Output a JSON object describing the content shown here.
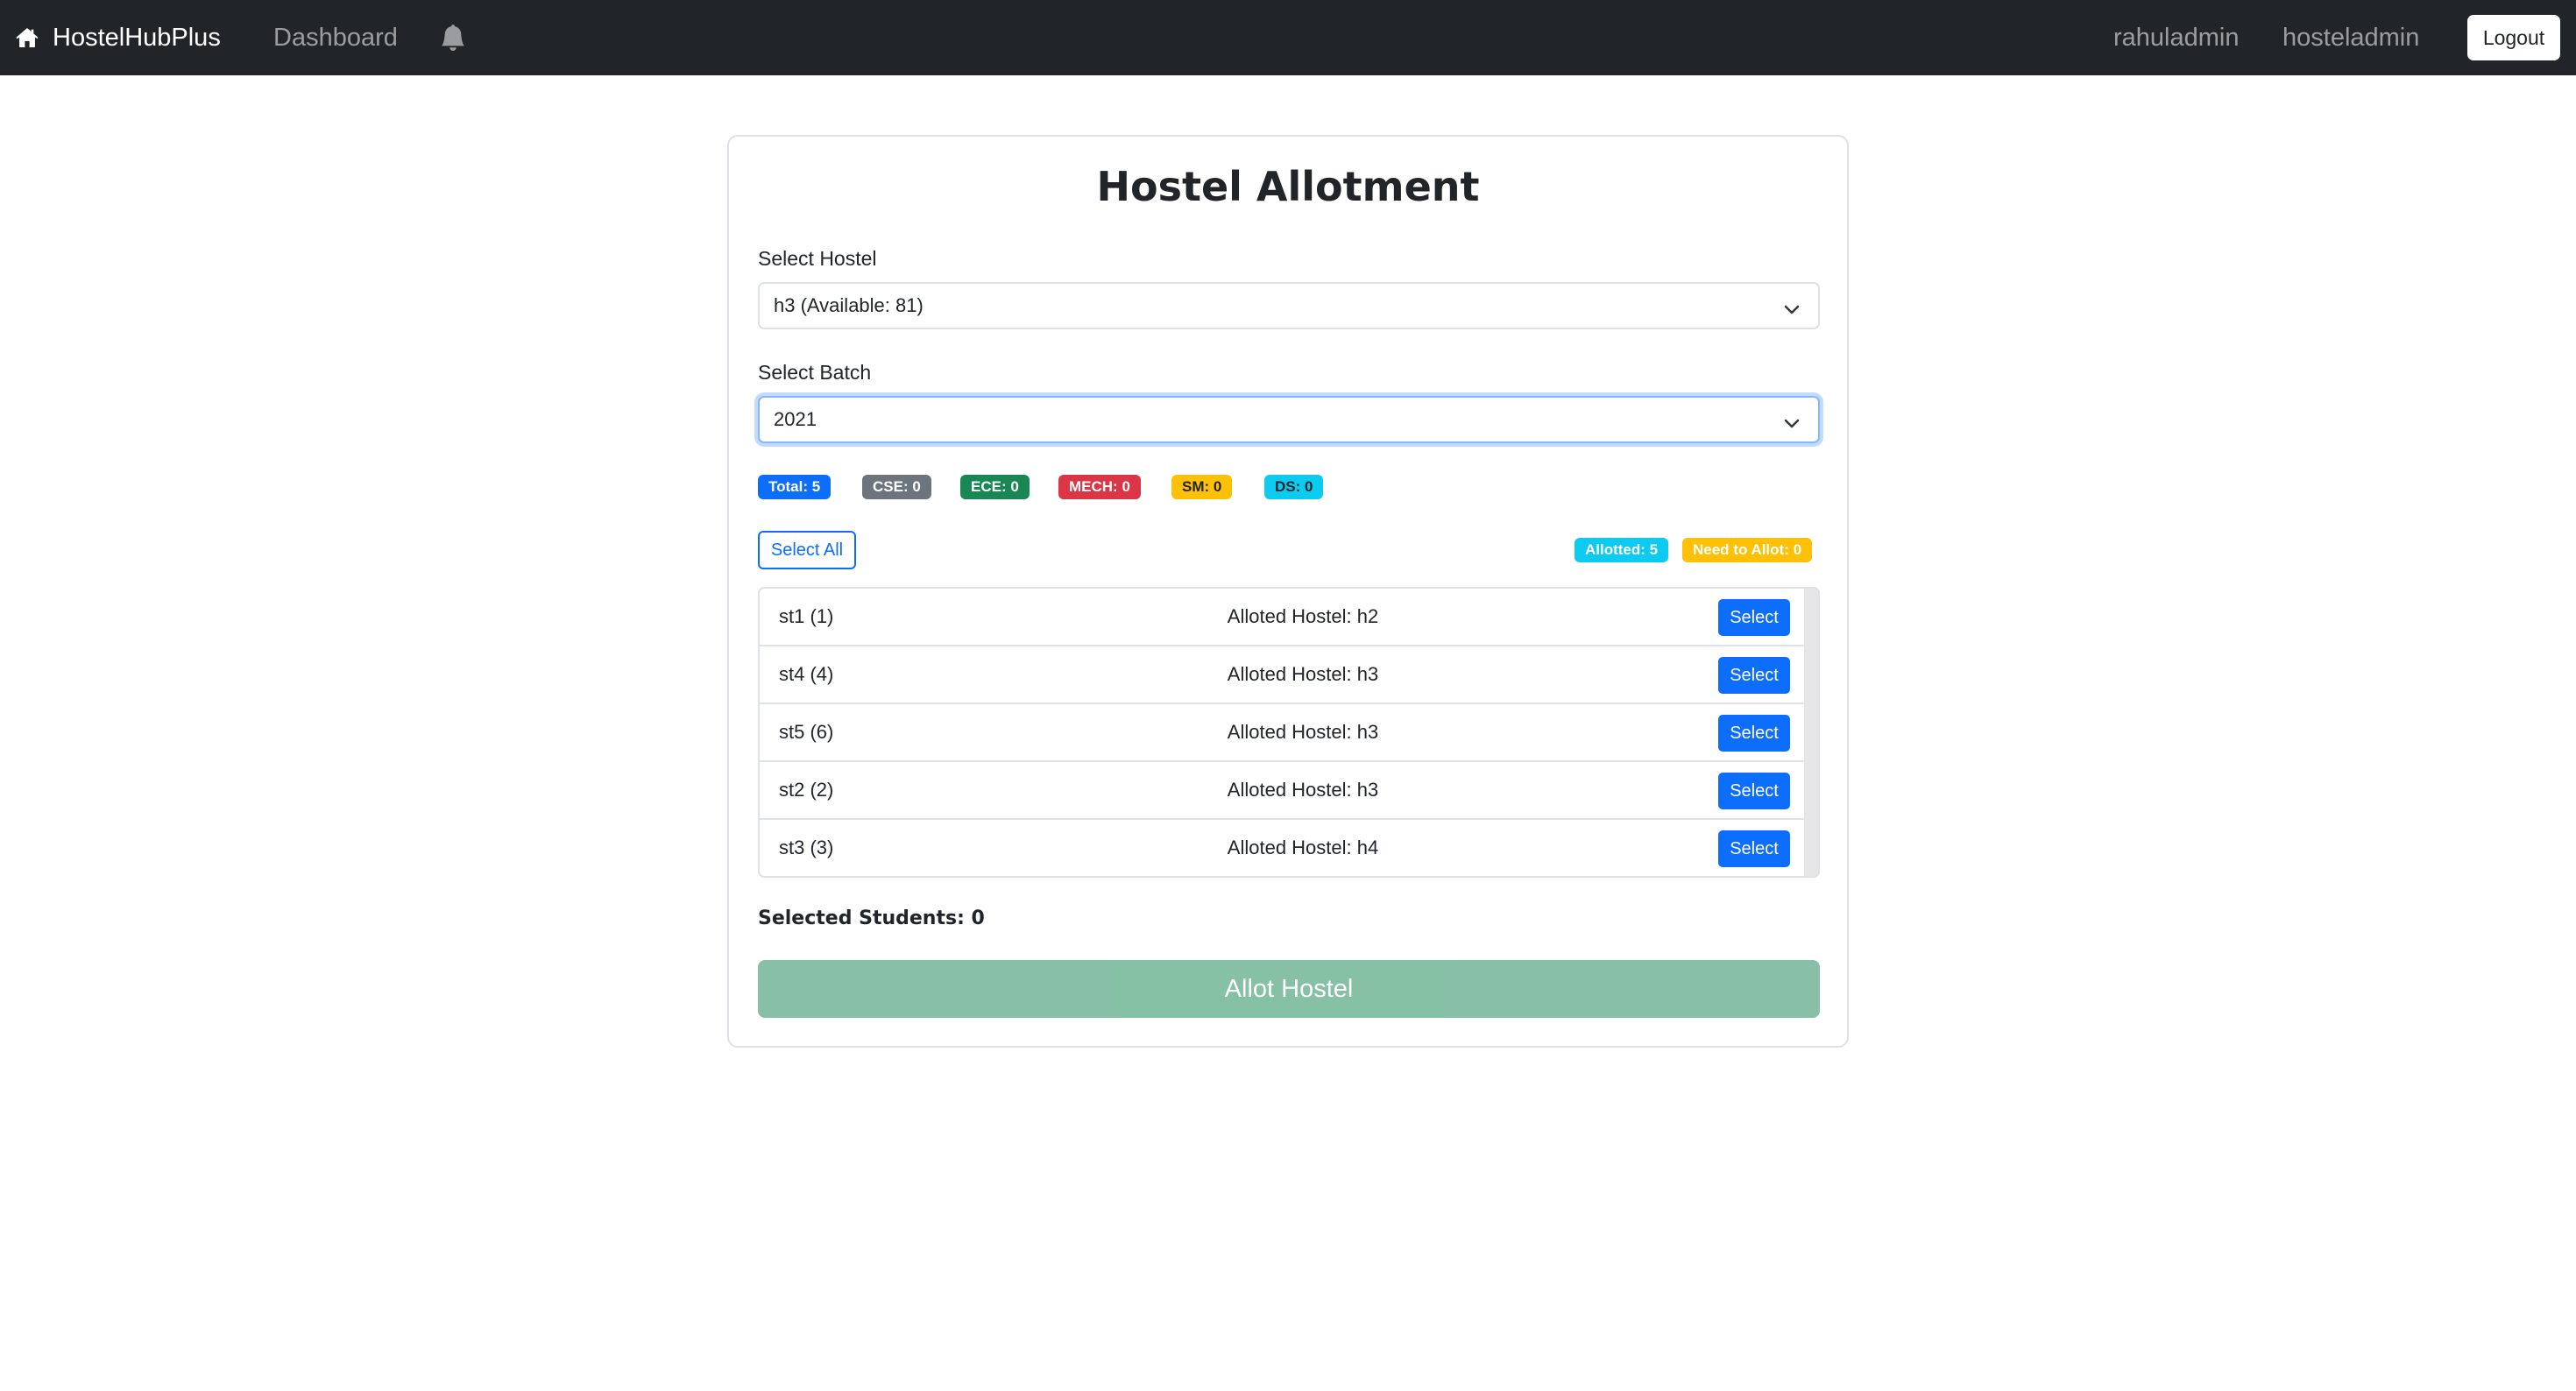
{
  "navbar": {
    "brand": "HostelHubPlus",
    "dashboard": "Dashboard",
    "user": "rahuladmin",
    "role": "hosteladmin",
    "logout": "Logout"
  },
  "page": {
    "title": "Hostel Allotment"
  },
  "hostel_select": {
    "label": "Select Hostel",
    "value": "h3 (Available: 81)"
  },
  "batch_select": {
    "label": "Select Batch",
    "value": "2021"
  },
  "stats": {
    "total": "Total: 5",
    "cse": "CSE: 0",
    "ece": "ECE: 0",
    "mech": "MECH: 0",
    "sm": "SM: 0",
    "ds": "DS: 0"
  },
  "actions": {
    "select_all": "Select All",
    "allotted": "Allotted: 5",
    "need_to_allot": "Need to Allot: 0"
  },
  "students": [
    {
      "name": "st1 (1)",
      "hostel": "Alloted Hostel: h2",
      "button": "Select"
    },
    {
      "name": "st4 (4)",
      "hostel": "Alloted Hostel: h3",
      "button": "Select"
    },
    {
      "name": "st5 (6)",
      "hostel": "Alloted Hostel: h3",
      "button": "Select"
    },
    {
      "name": "st2 (2)",
      "hostel": "Alloted Hostel: h3",
      "button": "Select"
    },
    {
      "name": "st3 (3)",
      "hostel": "Alloted Hostel: h4",
      "button": "Select"
    }
  ],
  "footer": {
    "selected": "Selected Students: 0",
    "allot_button": "Allot Hostel"
  },
  "colors": {
    "navbar_bg": "#212529",
    "primary": "#0d6efd",
    "success": "#198754",
    "secondary": "#6c757d",
    "danger": "#dc3545",
    "warning": "#ffc107",
    "info": "#0dcaf0"
  },
  "icons": {
    "brand": "home-icon",
    "notifications": "bell-icon",
    "dropdown": "chevron-down-icon"
  }
}
